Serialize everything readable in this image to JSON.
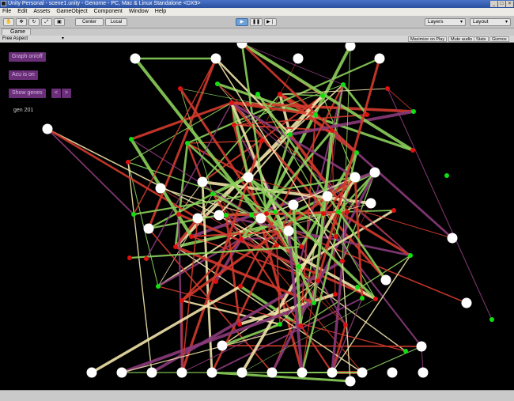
{
  "window": {
    "title": "Unity Personal - scene1.unity - Genome - PC, Mac & Linux Standalone <DX9>",
    "controls": [
      "_",
      "□",
      "×"
    ]
  },
  "menu": [
    "File",
    "Edit",
    "Assets",
    "GameObject",
    "Component",
    "Window",
    "Help"
  ],
  "toolbar": {
    "tools": [
      "hand-icon",
      "move-icon",
      "rotate-icon",
      "scale-icon",
      "rect-icon"
    ],
    "center_label": "Center",
    "local_label": "Local",
    "play_icons": [
      "play-icon",
      "pause-icon",
      "step-icon"
    ],
    "layers_label": "Layers",
    "layout_label": "Layout"
  },
  "tab": {
    "label": "Game"
  },
  "game_toolbar": {
    "aspect": "Free Aspect",
    "buttons": [
      "Maximize on Play",
      "Mute audio",
      "Stats",
      "Gizmos"
    ]
  },
  "ui": {
    "graph_button": "Graph on/off",
    "acu_button": "Acu is on",
    "genes_button": "Show genes",
    "small_a": "<",
    "small_b": ">",
    "gen_label": "gen 201"
  },
  "colors": {
    "viewport_bg": "#000000",
    "red_edge": "#d33a2c",
    "green_edge": "#8bcf5a",
    "cream_edge": "#efe2a8",
    "purple_edge": "#8a3a7a",
    "node_white": "#ffffff",
    "node_red": "#e01010",
    "node_green": "#10e010",
    "ui_button": "#6a2f78"
  }
}
